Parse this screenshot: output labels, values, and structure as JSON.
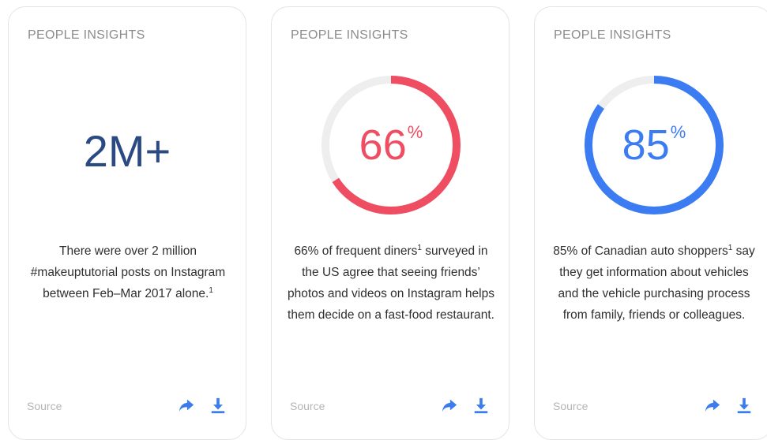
{
  "colors": {
    "navy": "#2c4a82",
    "red": "#ee4d62",
    "blue": "#3c7cf2",
    "track": "#eeeeee",
    "icon_blue": "#3b7ded"
  },
  "cards": [
    {
      "label": "PEOPLE INSIGHTS",
      "stat": "2M+",
      "description": "There were over 2 million #makeuptutorial posts on Instagram between Feb–Mar 2017 alone.",
      "footnote": "1",
      "source": "Source",
      "icons": [
        "share-icon",
        "download-icon"
      ]
    },
    {
      "label": "PEOPLE INSIGHTS",
      "percent_value": "66",
      "percent_sign": "%",
      "progress_fraction": 0.66,
      "desc_part1": "66% of frequent diners",
      "footnote": "1",
      "desc_part2": " surveyed in the US agree that seeing friends’ photos and videos on Instagram helps them decide on a fast-food restaurant.",
      "source": "Source",
      "icons": [
        "share-icon",
        "download-icon"
      ]
    },
    {
      "label": "PEOPLE INSIGHTS",
      "percent_value": "85",
      "percent_sign": "%",
      "progress_fraction": 0.85,
      "desc_part1": "85% of Canadian auto shoppers",
      "footnote": "1",
      "desc_part2": " say they get information about vehicles and the vehicle purchasing process from family, friends or colleagues.",
      "source": "Source",
      "icons": [
        "share-icon",
        "download-icon"
      ]
    }
  ]
}
